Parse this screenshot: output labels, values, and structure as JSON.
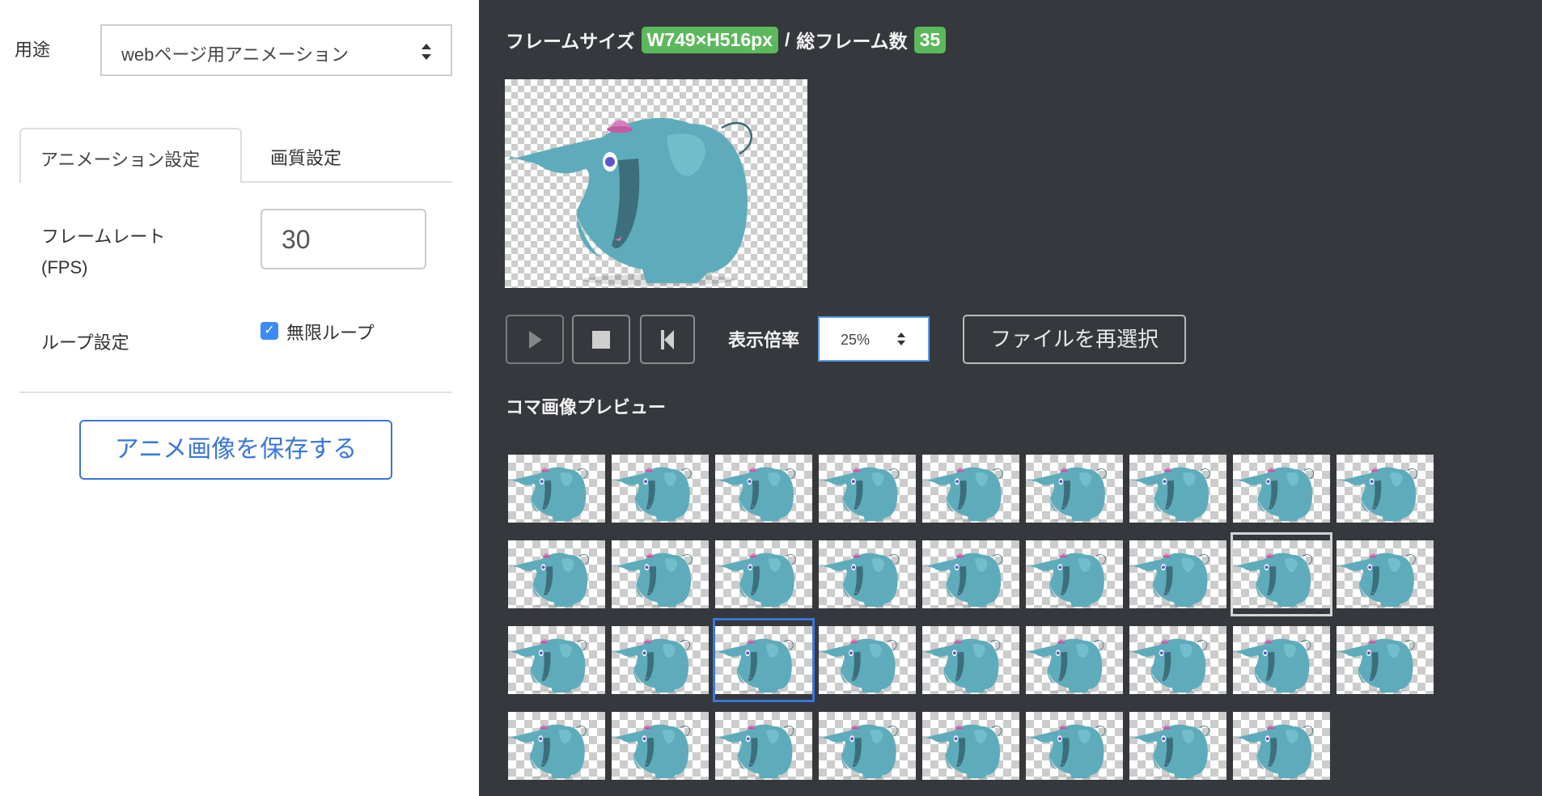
{
  "settings": {
    "usage_label": "用途",
    "usage_value": "webページ用アニメーション",
    "tabs": [
      {
        "label": "アニメーション設定",
        "active": true
      },
      {
        "label": "画質設定",
        "active": false
      }
    ],
    "fps_label_line1": "フレームレート",
    "fps_label_line2": "(FPS)",
    "fps_value": "30",
    "loop_label": "ループ設定",
    "loop_checkbox_label": "無限ループ",
    "loop_checked": true,
    "save_button": "アニメ画像を保存する"
  },
  "preview": {
    "frame_size_label": "フレームサイズ",
    "frame_size_value": "W749×H516px",
    "separator": "/",
    "total_frames_label": "総フレーム数",
    "total_frames_value": "35",
    "zoom_label": "表示倍率",
    "zoom_value": "25%",
    "reselect_button": "ファイルを再選択",
    "frames_title": "コマ画像プレビュー",
    "frame_count": 35,
    "columns": 9,
    "selected_frame": 21,
    "hovered_frame": 17
  },
  "colors": {
    "accent": "#3a77d8",
    "badge": "#5cb85c",
    "dark_bg": "#35383c",
    "elephant": "#5eacbb",
    "hat": "#d77fbd"
  }
}
